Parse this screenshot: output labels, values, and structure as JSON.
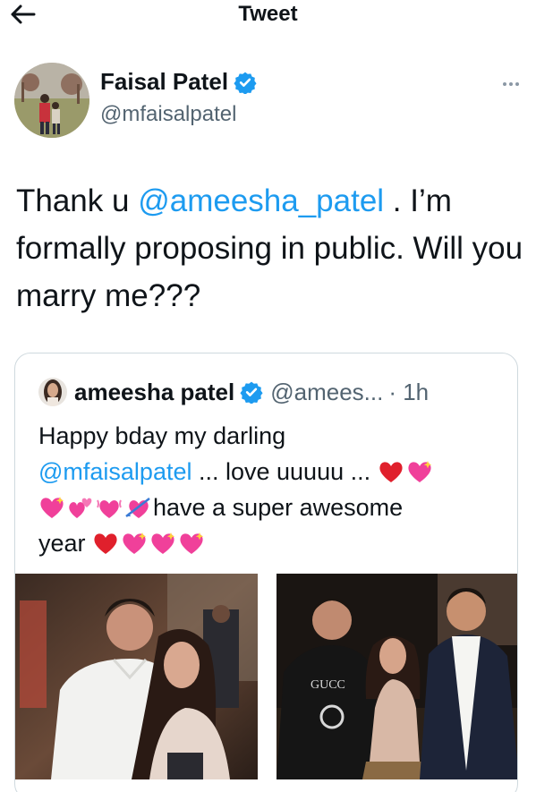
{
  "header": {
    "title": "Tweet",
    "back_icon": "arrow-left-icon"
  },
  "author": {
    "name": "Faisal Patel",
    "handle": "@mfaisalpatel",
    "verified": true,
    "more_icon": "more-horizontal-icon"
  },
  "tweet": {
    "text_before": "Thank u ",
    "mention": "@ameesha_patel",
    "text_after": " . I’m formally proposing in public. Will you marry me???"
  },
  "quote": {
    "name": "ameesha patel",
    "handle": "@amees...",
    "time": "· 1h",
    "text_line1": "Happy bday my darling",
    "mention": "@mfaisalpatel",
    "text_love": " ... love uuuuu ... ",
    "text_super": "have a super awesome",
    "text_year": "year "
  },
  "colors": {
    "accent": "#1d9bf0",
    "text": "#0f1419",
    "secondary": "#536471",
    "border": "#cfd9de"
  }
}
